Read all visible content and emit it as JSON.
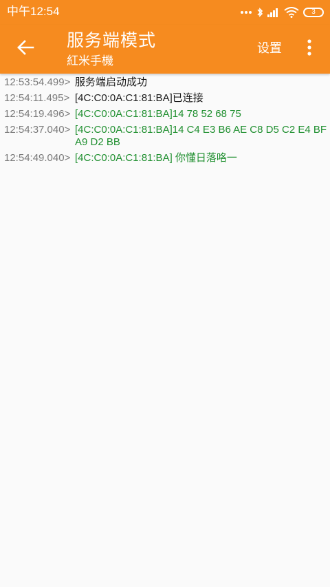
{
  "status_bar": {
    "time": "中午12:54",
    "battery_level": "3"
  },
  "app_bar": {
    "title": "服务端模式",
    "subtitle": "紅米手機",
    "settings_label": "设置",
    "icons": {
      "back": "arrow-back-icon",
      "overflow": "more-vert-icon"
    }
  },
  "colors": {
    "accent": "#f68b1f",
    "data_text": "#1f8f2f",
    "timestamp_text": "#7a7a7a"
  },
  "log": [
    {
      "time": "12:53:54.499>",
      "message": "服务端启动成功",
      "kind": "info"
    },
    {
      "time": "12:54:11.495>",
      "message": "[4C:C0:0A:C1:81:BA]已连接",
      "kind": "info"
    },
    {
      "time": "12:54:19.496>",
      "message": "[4C:C0:0A:C1:81:BA]14 78 52 68 75",
      "kind": "data"
    },
    {
      "time": "12:54:37.040>",
      "message": "[4C:C0:0A:C1:81:BA]14 C4 E3 B6 AE C8 D5 C2 E4 BF A9 D2 BB",
      "kind": "data"
    },
    {
      "time": "12:54:49.040>",
      "message": "[4C:C0:0A:C1:81:BA] 你懂日落咯一",
      "kind": "data"
    }
  ]
}
